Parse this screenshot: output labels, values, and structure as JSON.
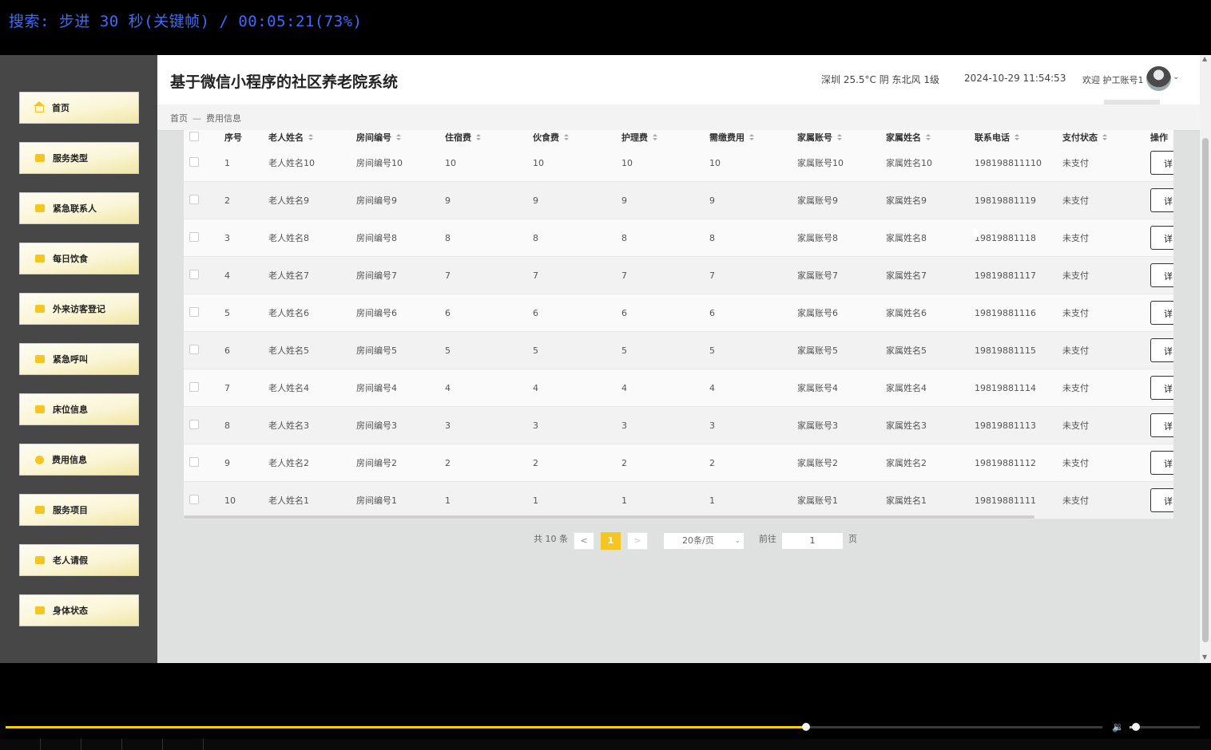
{
  "osd": {
    "text": "搜索: 步进 30 秒(关键帧) / 00:05:21(73%)"
  },
  "sidebar": {
    "items": [
      {
        "label": "首页",
        "icon": "home-icon"
      },
      {
        "label": "服务类型",
        "icon": "folder-icon"
      },
      {
        "label": "紧急联系人",
        "icon": "contact-icon"
      },
      {
        "label": "每日饮食",
        "icon": "meal-icon"
      },
      {
        "label": "外来访客登记",
        "icon": "visitor-icon"
      },
      {
        "label": "紧急呼叫",
        "icon": "call-icon"
      },
      {
        "label": "床位信息",
        "icon": "bed-icon"
      },
      {
        "label": "费用信息",
        "icon": "fee-icon"
      },
      {
        "label": "服务项目",
        "icon": "service-icon"
      },
      {
        "label": "老人请假",
        "icon": "leave-icon"
      },
      {
        "label": "身体状态",
        "icon": "health-icon"
      }
    ]
  },
  "header": {
    "title": "基于微信小程序的社区养老院系统",
    "weather": "深圳 25.5°C 阴 东北风 1级",
    "datetime": "2024-10-29 11:54:53",
    "welcome": "欢迎 护工账号1"
  },
  "breadcrumb": {
    "home": "首页",
    "sep": "—",
    "current": "费用信息"
  },
  "table": {
    "headers": [
      "序号",
      "老人姓名",
      "房间编号",
      "住宿费",
      "伙食费",
      "护理费",
      "需缴费用",
      "家属账号",
      "家属姓名",
      "联系电话",
      "支付状态",
      "操作"
    ],
    "detail_label": "详",
    "rows": [
      [
        "1",
        "老人姓名10",
        "房间编号10",
        "10",
        "10",
        "10",
        "10",
        "家属账号10",
        "家属姓名10",
        "198198811110",
        "未支付"
      ],
      [
        "2",
        "老人姓名9",
        "房间编号9",
        "9",
        "9",
        "9",
        "9",
        "家属账号9",
        "家属姓名9",
        "19819881119",
        "未支付"
      ],
      [
        "3",
        "老人姓名8",
        "房间编号8",
        "8",
        "8",
        "8",
        "8",
        "家属账号8",
        "家属姓名8",
        "19819881118",
        "未支付"
      ],
      [
        "4",
        "老人姓名7",
        "房间编号7",
        "7",
        "7",
        "7",
        "7",
        "家属账号7",
        "家属姓名7",
        "19819881117",
        "未支付"
      ],
      [
        "5",
        "老人姓名6",
        "房间编号6",
        "6",
        "6",
        "6",
        "6",
        "家属账号6",
        "家属姓名6",
        "19819881116",
        "未支付"
      ],
      [
        "6",
        "老人姓名5",
        "房间编号5",
        "5",
        "5",
        "5",
        "5",
        "家属账号5",
        "家属姓名5",
        "19819881115",
        "未支付"
      ],
      [
        "7",
        "老人姓名4",
        "房间编号4",
        "4",
        "4",
        "4",
        "4",
        "家属账号4",
        "家属姓名4",
        "19819881114",
        "未支付"
      ],
      [
        "8",
        "老人姓名3",
        "房间编号3",
        "3",
        "3",
        "3",
        "3",
        "家属账号3",
        "家属姓名3",
        "19819881113",
        "未支付"
      ],
      [
        "9",
        "老人姓名2",
        "房间编号2",
        "2",
        "2",
        "2",
        "2",
        "家属账号2",
        "家属姓名2",
        "19819881112",
        "未支付"
      ],
      [
        "10",
        "老人姓名1",
        "房间编号1",
        "1",
        "1",
        "1",
        "1",
        "家属账号1",
        "家属姓名1",
        "19819881111",
        "未支付"
      ]
    ]
  },
  "pagination": {
    "total": "共 10 条",
    "prev": "<",
    "page": "1",
    "next": ">",
    "page_size": "20条/页",
    "goto_label": "前往",
    "goto_value": "1",
    "page_suffix": "页"
  },
  "player": {
    "progress_fraction": 0.73,
    "volume_fraction": 0.05
  },
  "colors": {
    "accent": "#f3c623",
    "osd": "#3d6bff",
    "sidebar_bg": "#474747"
  }
}
